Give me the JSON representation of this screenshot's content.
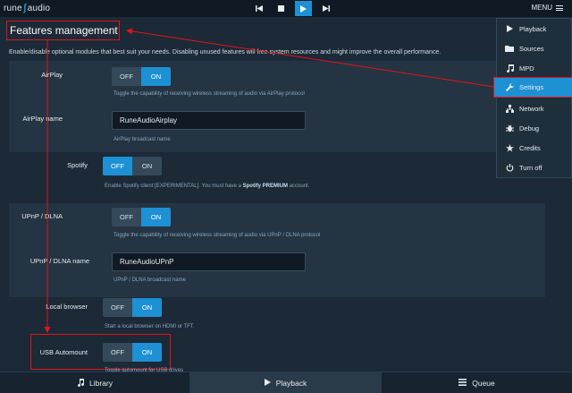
{
  "app": {
    "logo_left": "rune",
    "logo_right": "audio"
  },
  "topbar": {
    "menu_label": "MENU"
  },
  "page": {
    "title": "Features management",
    "intro": "Enable/disable optional modules that best suit your needs. Disabling unused features will free system resources and might improve the overall performance."
  },
  "features": {
    "airplay": {
      "label": "AirPlay",
      "off": "OFF",
      "on": "ON",
      "state": "on",
      "help": "Toggle the capability of receiving wireless streaming of audio via AirPlay protocol"
    },
    "airplay_name": {
      "label": "AirPlay name",
      "value": "RuneAudioAirplay",
      "help": "AirPlay broadcast name"
    },
    "spotify": {
      "label": "Spotify",
      "off": "OFF",
      "on": "ON",
      "state": "off",
      "help_pre": "Enable Spotify client [EXPERIMENTAL]. You must have a ",
      "help_bold": "Spotify PREMIUM",
      "help_post": " account."
    },
    "upnp": {
      "label": "UPnP / DLNA",
      "off": "OFF",
      "on": "ON",
      "state": "on",
      "help": "Toggle the capability of receiving wireless streaming of audio via UPnP / DLNA protocol"
    },
    "upnp_name": {
      "label": "UPnP / DLNA name",
      "value": "RuneAudioUPnP",
      "help": "UPnP / DLNA broadcast name"
    },
    "local_browser": {
      "label": "Local browser",
      "off": "OFF",
      "on": "ON",
      "state": "on",
      "help": "Start a local browser on HDMI or TFT."
    },
    "usb_automount": {
      "label": "USB Automount",
      "off": "OFF",
      "on": "ON",
      "state": "on",
      "help": "Toggle automount for USB drives"
    }
  },
  "menu": {
    "items": [
      {
        "label": "Playback",
        "icon": "play-icon"
      },
      {
        "label": "Sources",
        "icon": "folder-icon"
      },
      {
        "label": "MPD",
        "icon": "music-icon"
      },
      {
        "label": "Settings",
        "icon": "wrench-icon",
        "active": true
      },
      {
        "label": "Network",
        "icon": "network-icon"
      },
      {
        "label": "Debug",
        "icon": "bug-icon"
      },
      {
        "label": "Credits",
        "icon": "star-icon"
      },
      {
        "label": "Turn off",
        "icon": "power-icon"
      }
    ]
  },
  "bottom": {
    "library": "Library",
    "playback": "Playback",
    "queue": "Queue"
  },
  "colors": {
    "accent": "#1e90d4",
    "highlight": "#e0141e",
    "background": "#1c2936",
    "panel": "#243442"
  }
}
